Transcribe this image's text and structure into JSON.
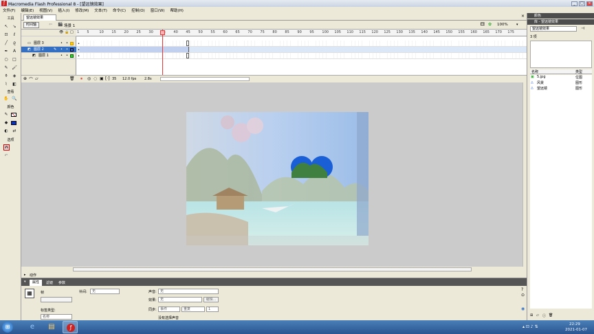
{
  "window": {
    "title": "Macromedia Flash Professional 8 - [望远镜效果]"
  },
  "menu": [
    "文件(F)",
    "编辑(E)",
    "视图(V)",
    "插入(I)",
    "修改(M)",
    "文本(T)",
    "命令(C)",
    "控制(O)",
    "窗口(W)",
    "帮助(H)"
  ],
  "toolbox": {
    "title": "工具",
    "view_label": "查看",
    "color_label": "颜色",
    "options_label": "选项"
  },
  "doc": {
    "tab": "望远镜效果",
    "timeline_btn": "时间轴",
    "scene": "场景 1",
    "zoom": "100%"
  },
  "timeline": {
    "layers": [
      {
        "name": "图层 3"
      },
      {
        "name": "图层 2"
      },
      {
        "name": "图层 1"
      }
    ],
    "ticks": [
      "1",
      "5",
      "10",
      "15",
      "20",
      "25",
      "30",
      "35",
      "40",
      "45",
      "50",
      "55",
      "60",
      "65",
      "70",
      "75",
      "80",
      "85",
      "90",
      "95",
      "100",
      "105",
      "110",
      "115",
      "120",
      "125",
      "130",
      "135",
      "140",
      "145",
      "150",
      "155",
      "160",
      "165",
      "170",
      "175"
    ],
    "current_frame": "35",
    "fps": "12.0 fps",
    "time": "2.8s"
  },
  "properties": {
    "tabs": [
      "属性",
      "滤镜",
      "参数"
    ],
    "actions_label": "动作",
    "frame_label": "帧",
    "tween_label": "补间:",
    "tween_value": "无",
    "sound_label": "声音:",
    "sound_value": "无",
    "effect_label": "效果:",
    "effect_value": "无",
    "edit_btn": "编辑...",
    "sync_label": "同步:",
    "sync_value": "事件",
    "repeat_value": "重复",
    "repeat_count": "1",
    "no_sound": "没有选择声音",
    "label_type_label": "标签类型:",
    "label_type_value": "名称"
  },
  "rightpanel": {
    "color_header": "颜色",
    "library_header": "库 - 望远镜效果",
    "library_select": "望远镜效果",
    "item_count": "3 项",
    "col_name": "名称",
    "col_type": "类型",
    "items": [
      {
        "name": "5.jpg",
        "type": "位图"
      },
      {
        "name": "风景",
        "type": "图形"
      },
      {
        "name": "望远镜",
        "type": "图形"
      }
    ]
  },
  "taskbar": {
    "time": "22:29",
    "date": "2021-01-07"
  }
}
